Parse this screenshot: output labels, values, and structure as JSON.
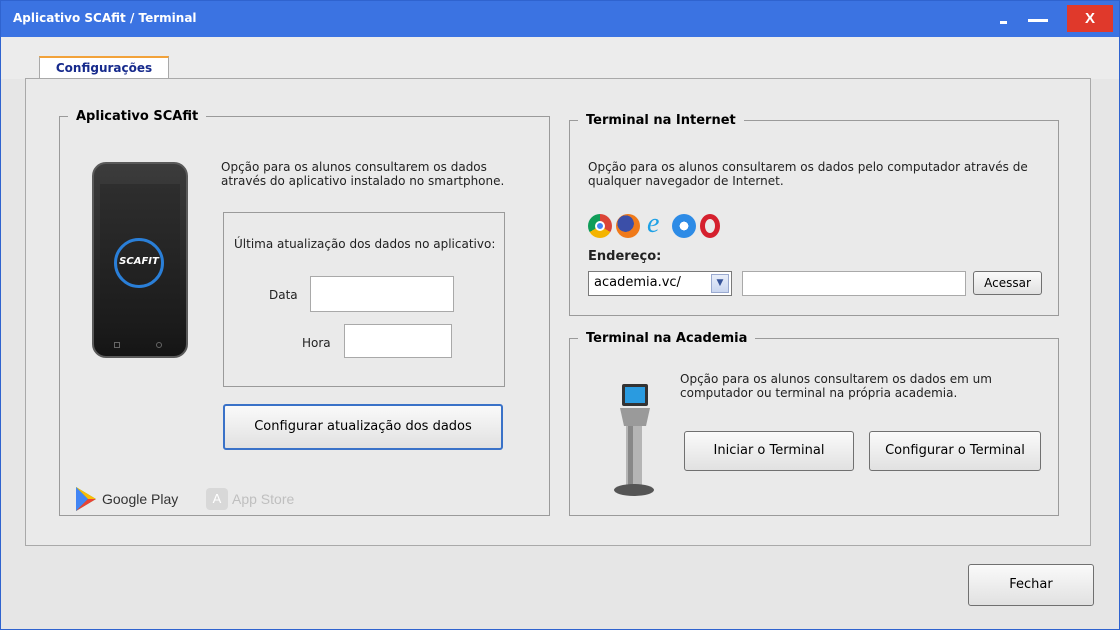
{
  "window": {
    "title": "Aplicativo SCAfit / Terminal",
    "close_label": "X"
  },
  "tabs": [
    {
      "label": "Configurações"
    }
  ],
  "app_group": {
    "legend": "Aplicativo SCAfit",
    "description": "Opção para os alunos consultarem os dados através do aplicativo instalado no smartphone.",
    "phone_logo": "SCAFIT",
    "last_update_label": "Última atualização dos dados no aplicativo:",
    "date_label": "Data",
    "date_value": "",
    "time_label": "Hora",
    "time_value": "",
    "configure_button": "Configurar atualização dos dados",
    "google_play": "Google Play",
    "app_store": "App Store"
  },
  "internet_group": {
    "legend": "Terminal na Internet",
    "description": "Opção para os alunos consultarem os dados pelo computador através de qualquer navegador de Internet.",
    "browsers": [
      "chrome-icon",
      "firefox-icon",
      "ie-icon",
      "safari-icon",
      "opera-icon"
    ],
    "address_label": "Endereço:",
    "address_selected": "academia.vc/",
    "address_value": "",
    "access_button": "Acessar"
  },
  "academy_group": {
    "legend": "Terminal na Academia",
    "description": "Opção para os alunos consultarem os dados em um computador ou terminal na própria academia.",
    "start_button": "Iniciar o Terminal",
    "configure_button": "Configurar o Terminal"
  },
  "footer": {
    "close_button": "Fechar"
  },
  "colors": {
    "titlebar": "#3b73e2",
    "close": "#e0392b",
    "tab_accent": "#f2a23a",
    "tab_text": "#162a8c"
  }
}
